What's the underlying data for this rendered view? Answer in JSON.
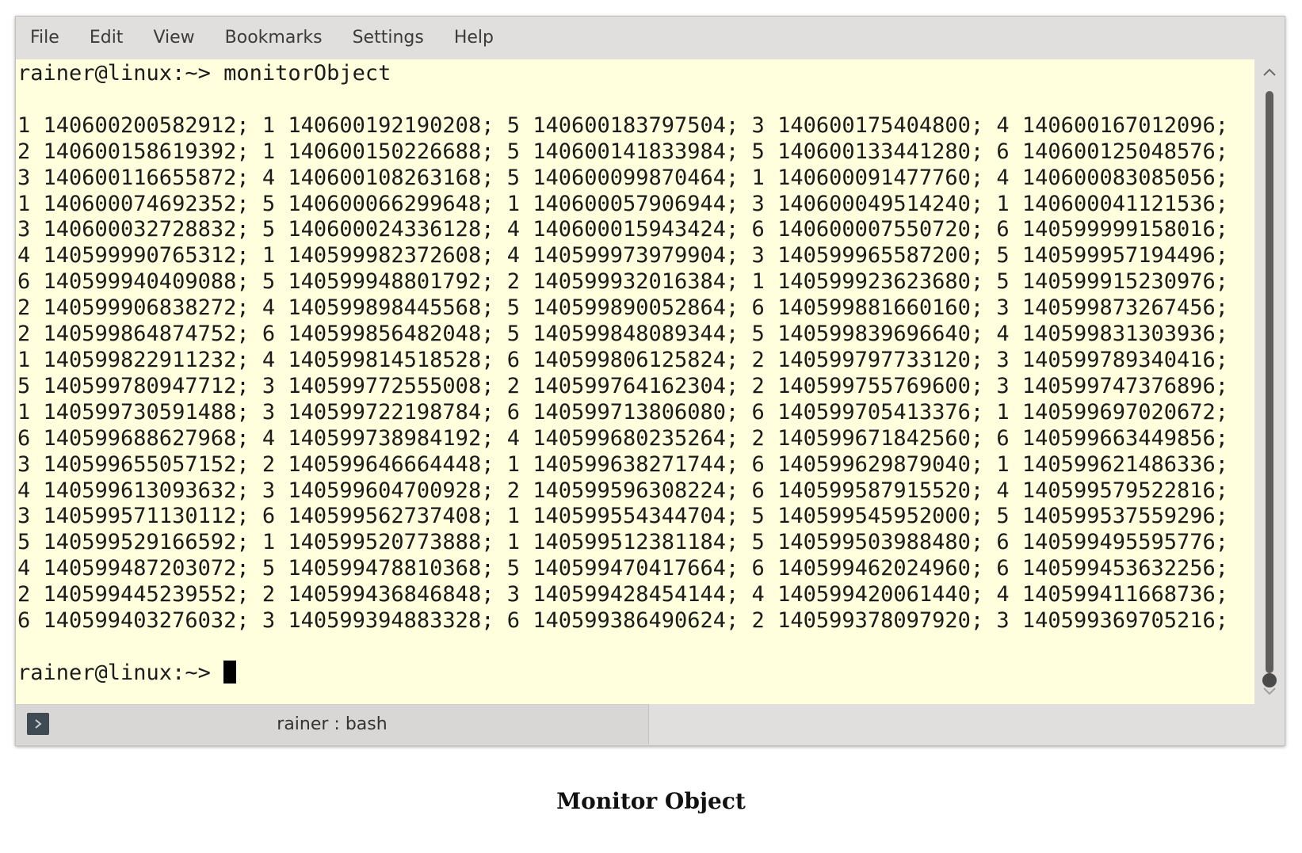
{
  "menubar": {
    "items": [
      "File",
      "Edit",
      "View",
      "Bookmarks",
      "Settings",
      "Help"
    ]
  },
  "terminal": {
    "command_line": "rainer@linux:~> monitorObject",
    "output_lines": [
      "1 140600200582912; 1 140600192190208; 5 140600183797504; 3 140600175404800; 4 140600167012096;",
      "2 140600158619392; 1 140600150226688; 5 140600141833984; 5 140600133441280; 6 140600125048576;",
      "3 140600116655872; 4 140600108263168; 5 140600099870464; 1 140600091477760; 4 140600083085056;",
      "1 140600074692352; 5 140600066299648; 1 140600057906944; 3 140600049514240; 1 140600041121536;",
      "3 140600032728832; 5 140600024336128; 4 140600015943424; 6 140600007550720; 6 140599999158016;",
      "4 140599990765312; 1 140599982372608; 4 140599973979904; 3 140599965587200; 5 140599957194496;",
      "6 140599940409088; 5 140599948801792; 2 140599932016384; 1 140599923623680; 5 140599915230976;",
      "2 140599906838272; 4 140599898445568; 5 140599890052864; 6 140599881660160; 3 140599873267456;",
      "2 140599864874752; 6 140599856482048; 5 140599848089344; 5 140599839696640; 4 140599831303936;",
      "1 140599822911232; 4 140599814518528; 6 140599806125824; 2 140599797733120; 3 140599789340416;",
      "5 140599780947712; 3 140599772555008; 2 140599764162304; 2 140599755769600; 3 140599747376896;",
      "1 140599730591488; 3 140599722198784; 6 140599713806080; 6 140599705413376; 1 140599697020672;",
      "6 140599688627968; 4 140599738984192; 4 140599680235264; 2 140599671842560; 6 140599663449856;",
      "3 140599655057152; 2 140599646664448; 1 140599638271744; 6 140599629879040; 1 140599621486336;",
      "4 140599613093632; 3 140599604700928; 2 140599596308224; 6 140599587915520; 4 140599579522816;",
      "3 140599571130112; 6 140599562737408; 1 140599554344704; 5 140599545952000; 5 140599537559296;",
      "5 140599529166592; 1 140599520773888; 1 140599512381184; 5 140599503988480; 6 140599495595776;",
      "4 140599487203072; 5 140599478810368; 5 140599470417664; 6 140599462024960; 6 140599453632256;",
      "2 140599445239552; 2 140599436846848; 3 140599428454144; 4 140599420061440; 4 140599411668736;",
      "6 140599403276032; 3 140599394883328; 6 140599386490624; 2 140599378097920; 3 140599369705216;"
    ],
    "prompt": "rainer@linux:~> "
  },
  "tabbar": {
    "tab_label": "rainer : bash",
    "tab_icon": "terminal-prompt-icon"
  },
  "caption": "Monitor Object",
  "colors": {
    "terminal_background": "#fffedd",
    "window_chrome": "#e0dfde"
  }
}
